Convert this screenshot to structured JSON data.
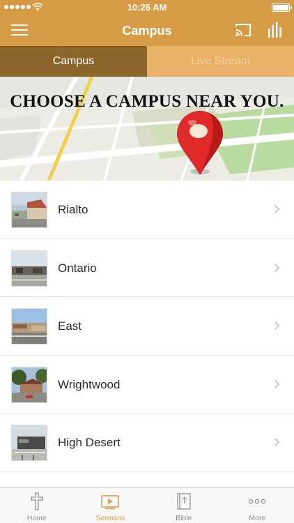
{
  "status_bar": {
    "time": "10:26 AM"
  },
  "navbar": {
    "title": "Campus",
    "icons": [
      "menu-icon",
      "cast-icon",
      "stats-icon"
    ]
  },
  "tabs": [
    {
      "label": "Campus",
      "selected": true
    },
    {
      "label": "Live Stream",
      "selected": false
    }
  ],
  "banner": {
    "title": "CHOOSE A CAMPUS NEAR YOU."
  },
  "campuses": [
    {
      "name": "Rialto"
    },
    {
      "name": "Ontario"
    },
    {
      "name": "East"
    },
    {
      "name": "Wrightwood"
    },
    {
      "name": "High Desert"
    }
  ],
  "tabbar": {
    "items": [
      {
        "label": "Home",
        "icon": "cross-icon",
        "active": false
      },
      {
        "label": "Sermons",
        "icon": "video-icon",
        "active": true
      },
      {
        "label": "Bible",
        "icon": "bible-icon",
        "active": false
      },
      {
        "label": "More",
        "icon": "more-icon",
        "active": false
      }
    ]
  },
  "colors": {
    "brand": "#d79a45",
    "tab_active": "#8c652c",
    "tab_inactive": "#e7b166",
    "pin": "#e02a2a"
  }
}
